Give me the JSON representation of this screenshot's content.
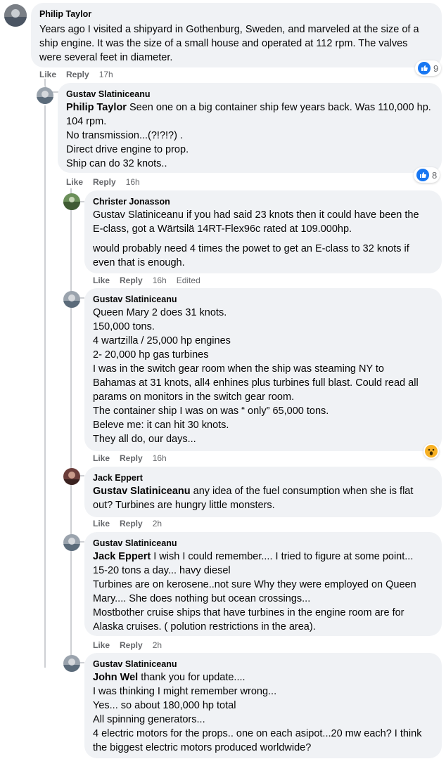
{
  "comments": [
    {
      "author": "Philip Taylor",
      "lines": [
        "Years ago I visited a shipyard in Gothenburg, Sweden, and marveled at the size of a",
        "ship engine. It was the size of a small house and operated at 112 rpm. The valves",
        "were several feet in diameter."
      ],
      "like": "Like",
      "reply": "Reply",
      "time": "17h",
      "reactions": "9"
    },
    {
      "author": "Gustav Slatiniceanu",
      "mention": "Philip Taylor",
      "first_line": "Seen one on a big container ship few years back. Was 110,000 hp.",
      "lines": [
        "104 rpm.",
        "No transmission...(?!?!?) .",
        "Direct drive engine to prop.",
        "Ship can do 32 knots.."
      ],
      "like": "Like",
      "reply": "Reply",
      "time": "16h",
      "reactions": "8"
    },
    {
      "author": "Christer Jonasson",
      "lines": [
        "Gustav Slatiniceanu if you had said 23 knots then it could have been the",
        "E-class, got a Wärtsilä 14RT-Flex96c rated at 109.000hp."
      ],
      "lines2": [
        "would probably need 4 times the powet to get an E-class to 32 knots if",
        "even that is enough."
      ],
      "like": "Like",
      "reply": "Reply",
      "time": "16h",
      "edited": "Edited"
    },
    {
      "author": "Gustav Slatiniceanu",
      "lines": [
        "Queen Mary 2 does 31 knots.",
        "150,000 tons.",
        "4 wartzilla / 25,000 hp engines",
        "2- 20,000 hp gas turbines",
        "I was in the switch gear room when the ship was steaming NY to",
        "Bahamas at 31 knots, all4 enhines plus turbines full blast. Could read all",
        "params on monitors in the switch gear room.",
        "The container ship I was on was “ only” 65,000 tons.",
        "Beleve me: it can hit 30 knots.",
        "They all do, our days..."
      ],
      "like": "Like",
      "reply": "Reply",
      "time": "16h"
    },
    {
      "author": "Jack Eppert",
      "mention": "Gustav Slatiniceanu",
      "first_line": "any idea of the fuel consumption when she is flat",
      "lines": [
        "out? Turbines are hungry little monsters."
      ],
      "like": "Like",
      "reply": "Reply",
      "time": "2h"
    },
    {
      "author": "Gustav Slatiniceanu",
      "mention": "Jack Eppert",
      "first_line": "I wish I could remember.... I tried to figure at some point...",
      "lines": [
        "15-20 tons a day... havy diesel",
        "Turbines are on kerosene..not sure Why they were employed on Queen",
        "Mary.... She does nothing but ocean crossings...",
        "Mostbother cruise ships that have turbines in the engine room are for",
        "Alaska cruises. ( polution restrictions in the area)."
      ],
      "like": "Like",
      "reply": "Reply",
      "time": "2h"
    },
    {
      "author": "Gustav Slatiniceanu",
      "mention": "John Wel",
      "first_line": "thank you for update....",
      "lines": [
        "I was thinking I might remember wrong...",
        "Yes... so about 180,000 hp total",
        "All spinning generators...",
        "4 electric motors for the props.. one on each asipot...20 mw each? I think",
        "the biggest electric motors produced worldwide?"
      ]
    }
  ],
  "colors": {
    "bubble": "#f0f2f5",
    "meta": "#65676b",
    "like_blue": "#1877f2",
    "wow_yellow": "#f7b125"
  }
}
